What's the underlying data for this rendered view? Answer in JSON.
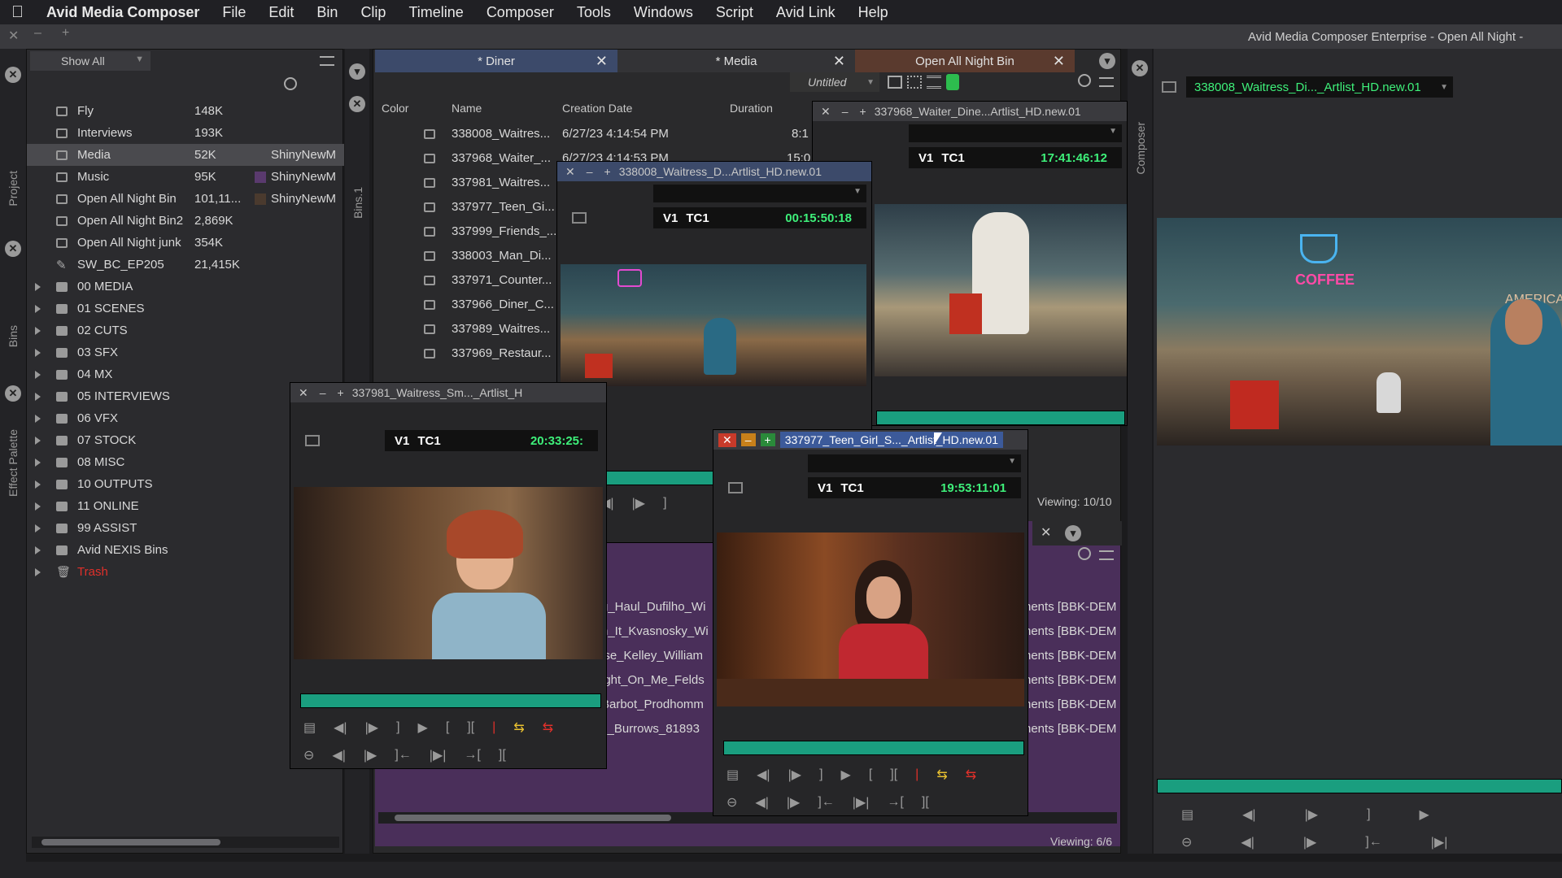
{
  "menubar": {
    "app": "Avid Media Composer",
    "items": [
      "File",
      "Edit",
      "Bin",
      "Clip",
      "Timeline",
      "Composer",
      "Tools",
      "Windows",
      "Script",
      "Avid Link",
      "Help"
    ]
  },
  "window_title": "Avid Media Composer Enterprise - Open All Night -",
  "project": {
    "filter": "Show All",
    "vtabs": {
      "project": "Project",
      "bins": "Bins",
      "effect": "Effect Palette"
    },
    "bins": [
      {
        "name": "Fly",
        "size": "148K",
        "owner": "",
        "kind": "bin"
      },
      {
        "name": "Interviews",
        "size": "193K",
        "owner": "",
        "kind": "bin"
      },
      {
        "name": "Media",
        "size": "52K",
        "owner": "ShinyNewM",
        "kind": "bin",
        "selected": true
      },
      {
        "name": "Music",
        "size": "95K",
        "owner": "ShinyNewM",
        "kind": "bin"
      },
      {
        "name": "Open All Night Bin",
        "size": "101,11...",
        "owner": "ShinyNewM",
        "kind": "bin"
      },
      {
        "name": "Open All Night Bin2",
        "size": "2,869K",
        "owner": "",
        "kind": "bin"
      },
      {
        "name": "Open All Night junk",
        "size": "354K",
        "owner": "",
        "kind": "bin"
      },
      {
        "name": "SW_BC_EP205",
        "size": "21,415K",
        "owner": "",
        "kind": "script"
      }
    ],
    "folders": [
      "00 MEDIA",
      "01 SCENES",
      "02 CUTS",
      "03 SFX",
      "04 MX",
      "05 INTERVIEWS",
      "06 VFX",
      "07 STOCK",
      "08 MISC",
      "10 OUTPUTS",
      "11 ONLINE",
      "99 ASSIST",
      "Avid NEXIS Bins"
    ],
    "trash": "Trash"
  },
  "bins_tab_label": "Bins.1",
  "bin": {
    "tabs": [
      "* Diner",
      "* Media",
      "Open All Night Bin"
    ],
    "view": "Untitled",
    "columns": {
      "color": "Color",
      "name": "Name",
      "date": "Creation Date",
      "duration": "Duration"
    },
    "rows": [
      {
        "name": "338008_Waitres...",
        "date": "6/27/23 4:14:54 PM",
        "duration": "8:1"
      },
      {
        "name": "337968_Waiter_...",
        "date": "6/27/23 4:14:53 PM",
        "duration": "15:0"
      },
      {
        "name": "337981_Waitres...",
        "date": "",
        "duration": ""
      },
      {
        "name": "337977_Teen_Gi...",
        "date": "",
        "duration": ""
      },
      {
        "name": "337999_Friends_...",
        "date": "",
        "duration": ""
      },
      {
        "name": "338003_Man_Di...",
        "date": "",
        "duration": ""
      },
      {
        "name": "337971_Counter...",
        "date": "",
        "duration": ""
      },
      {
        "name": "337966_Diner_C...",
        "date": "",
        "duration": ""
      },
      {
        "name": "337989_Waitres...",
        "date": "",
        "duration": ""
      },
      {
        "name": "337969_Restaur...",
        "date": "",
        "duration": ""
      }
    ],
    "viewing_top": "Viewing: 10/10",
    "viewing_bottom": "Viewing: 6/6"
  },
  "lower_bin_rows": [
    {
      "left": "g_Haul_Dufilho_Wi",
      "right": "nents [BBK-DEM"
    },
    {
      "left": "n_It_Kvasnosky_Wi",
      "right": "nents [BBK-DEM"
    },
    {
      "left": "ise_Kelley_William",
      "right": "nents [BBK-DEM"
    },
    {
      "left": "ight_On_Me_Felds",
      "right": "nents [BBK-DEM"
    },
    {
      "left": "Barbot_Prodhomm",
      "right": "nents [BBK-DEM"
    },
    {
      "left": "s_Burrows_81893",
      "right": "nents [BBK-DEM"
    }
  ],
  "monitors": {
    "m1": {
      "title": "337968_Waiter_Dine...Artlist_HD.new.01",
      "track": "V1",
      "tc": "TC1",
      "value": "17:41:46:12"
    },
    "m2": {
      "title": "338008_Waitress_D...Artlist_HD.new.01",
      "track": "V1",
      "tc": "TC1",
      "value": "00:15:50:18"
    },
    "m3": {
      "title": "337981_Waitress_Sm..._Artlist_H",
      "track": "V1",
      "tc": "TC1",
      "value": "20:33:25:"
    },
    "m4": {
      "title": "337977_Teen_Girl_S..._Artlist_HD.new.01",
      "track": "V1",
      "tc": "TC1",
      "value": "19:53:11:01"
    }
  },
  "composer": {
    "vtab": "Composer",
    "clip": "338008_Waitress_Di..._Artlist_HD.new.01",
    "sign": "COFFEE",
    "sign2": "AMERICA"
  },
  "colors": {
    "accent": "#3ef07a",
    "scrub": "#1a9e7f",
    "trash": "#e0302a",
    "purple": "#5a3a6e"
  }
}
